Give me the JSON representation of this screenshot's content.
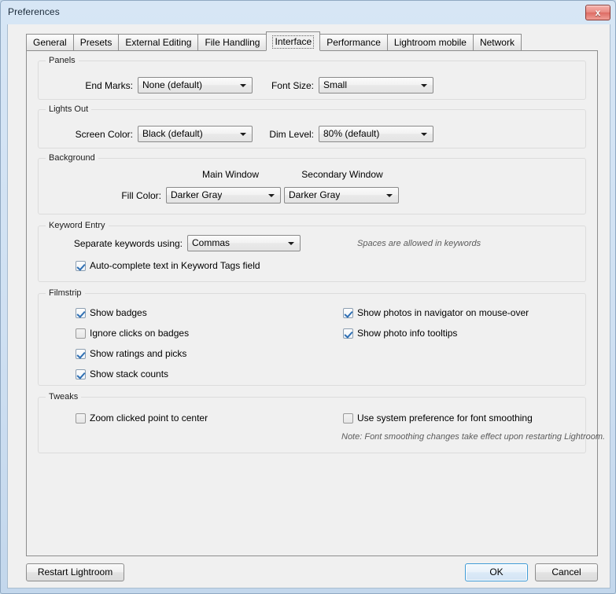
{
  "window": {
    "title": "Preferences",
    "close_label": "x",
    "close_icon": "close-icon"
  },
  "tabs": [
    {
      "label": "General",
      "selected": false
    },
    {
      "label": "Presets",
      "selected": false
    },
    {
      "label": "External Editing",
      "selected": false
    },
    {
      "label": "File Handling",
      "selected": false
    },
    {
      "label": "Interface",
      "selected": true
    },
    {
      "label": "Performance",
      "selected": false
    },
    {
      "label": "Lightroom mobile",
      "selected": false
    },
    {
      "label": "Network",
      "selected": false
    }
  ],
  "groups": {
    "panels": {
      "title": "Panels",
      "end_marks_label": "End Marks:",
      "end_marks_value": "None (default)",
      "font_size_label": "Font Size:",
      "font_size_value": "Small"
    },
    "lights_out": {
      "title": "Lights Out",
      "screen_color_label": "Screen Color:",
      "screen_color_value": "Black (default)",
      "dim_level_label": "Dim Level:",
      "dim_level_value": "80% (default)"
    },
    "background": {
      "title": "Background",
      "main_window_header": "Main Window",
      "secondary_window_header": "Secondary Window",
      "fill_color_label": "Fill Color:",
      "main_fill_value": "Darker Gray",
      "secondary_fill_value": "Darker Gray"
    },
    "keyword_entry": {
      "title": "Keyword Entry",
      "separate_label": "Separate keywords using:",
      "separate_value": "Commas",
      "spaces_hint": "Spaces are allowed in keywords",
      "autocomplete_label": "Auto-complete text in Keyword Tags field",
      "autocomplete_checked": true
    },
    "filmstrip": {
      "title": "Filmstrip",
      "options_left": [
        {
          "label": "Show badges",
          "checked": true
        },
        {
          "label": "Ignore clicks on badges",
          "checked": false
        },
        {
          "label": "Show ratings and picks",
          "checked": true
        },
        {
          "label": "Show stack counts",
          "checked": true
        }
      ],
      "options_right": [
        {
          "label": "Show photos in navigator on mouse-over",
          "checked": true
        },
        {
          "label": "Show photo info tooltips",
          "checked": true
        }
      ]
    },
    "tweaks": {
      "title": "Tweaks",
      "zoom_label": "Zoom clicked point to center",
      "zoom_checked": false,
      "font_smoothing_label": "Use system preference for font smoothing",
      "font_smoothing_checked": false,
      "note": "Note: Font smoothing changes take effect upon restarting Lightroom."
    }
  },
  "footer": {
    "restart_label": "Restart Lightroom",
    "ok_label": "OK",
    "cancel_label": "Cancel"
  },
  "colors": {
    "accent": "#3c9ad6",
    "window_chrome": "#cfe0f2",
    "panel_bg": "#f0f0f0",
    "close_red": "#dd6b63",
    "check_blue": "#2f6fb3"
  }
}
